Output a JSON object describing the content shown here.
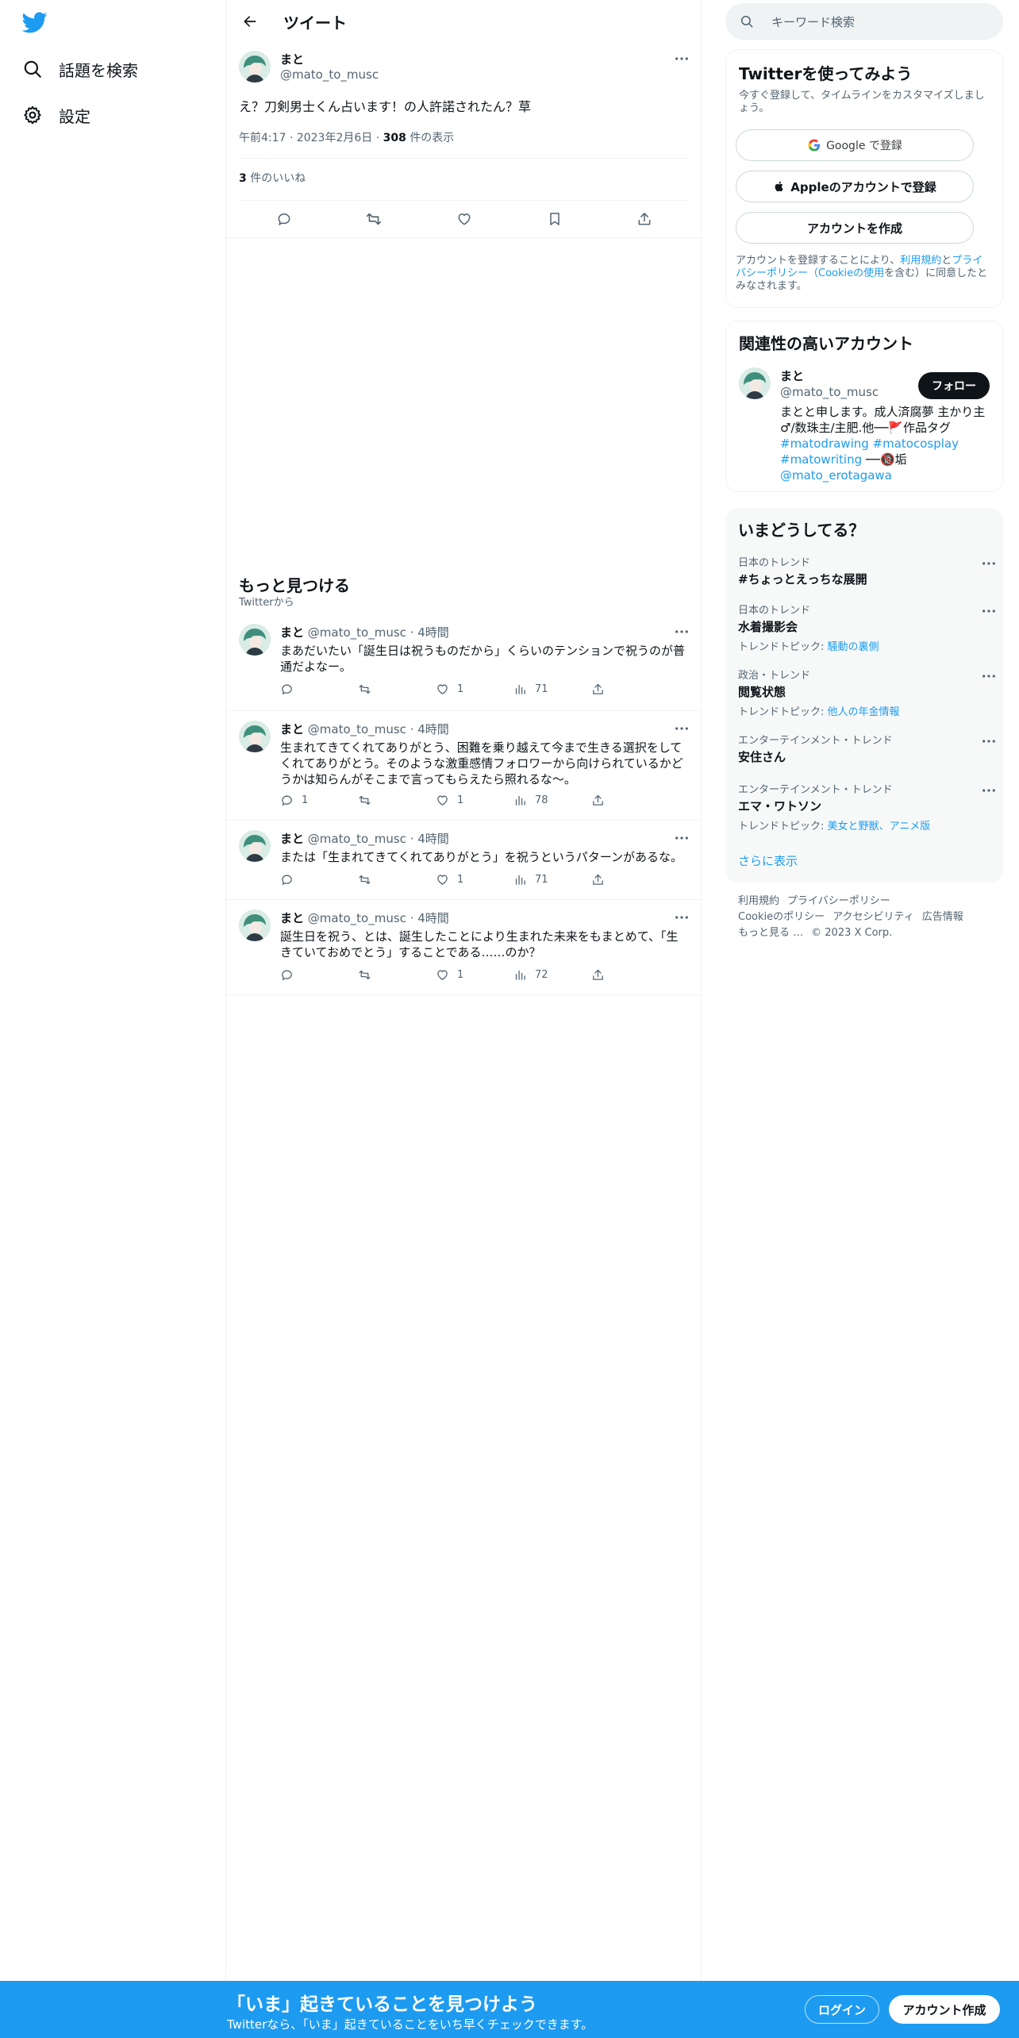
{
  "nav": {
    "items": [
      {
        "label": "話題を検索"
      },
      {
        "label": "設定"
      }
    ]
  },
  "header": {
    "title": "ツイート"
  },
  "tweet": {
    "name": "まと",
    "handle": "@mato_to_musc",
    "text": "え？刀剣男士くん占います！の人許諾されたん？草",
    "time": "午前4:17",
    "date": "2023年2月6日",
    "views_count": "308",
    "views_label": "件の表示",
    "likes_count": "3",
    "likes_label": "件のいいね"
  },
  "more": {
    "title": "もっと見つける",
    "subtitle": "Twitterから",
    "tweets": [
      {
        "name": "まと",
        "handle": "@mato_to_musc",
        "time": "4時間",
        "text": "まあだいたい「誕生日は祝うものだから」くらいのテンションで祝うのが普通だよなー。",
        "replies": "",
        "retweets": "",
        "likes": "1",
        "views": "71"
      },
      {
        "name": "まと",
        "handle": "@mato_to_musc",
        "time": "4時間",
        "text": "生まれてきてくれてありがとう、困難を乗り越えて今まで生きる選択をしてくれてありがとう。そのような激重感情フォロワーから向けられているかどうかは知らんがそこまで言ってもらえたら照れるな〜。",
        "replies": "1",
        "retweets": "",
        "likes": "1",
        "views": "78"
      },
      {
        "name": "まと",
        "handle": "@mato_to_musc",
        "time": "4時間",
        "text": "または「生まれてきてくれてありがとう」を祝うというパターンがあるな。",
        "replies": "",
        "retweets": "",
        "likes": "1",
        "views": "71"
      },
      {
        "name": "まと",
        "handle": "@mato_to_musc",
        "time": "4時間",
        "text": "誕生日を祝う、とは、誕生したことにより生まれた未来をもまとめて、「生きていておめでとう」することである……のか？",
        "replies": "",
        "retweets": "",
        "likes": "1",
        "views": "72"
      }
    ]
  },
  "sidebar": {
    "search_placeholder": "キーワード検索",
    "signup": {
      "title": "Twitterを使ってみよう",
      "subtitle": "今すぐ登録して、タイムラインをカスタマイズしましょう。",
      "google": "Google で登録",
      "apple": "Appleのアカウントで登録",
      "create": "アカウントを作成",
      "legal_prefix": "アカウントを登録することにより、",
      "legal_terms": "利用規約",
      "legal_and": "と",
      "legal_privacy": "プライバシーポリシー",
      "legal_open": "（",
      "legal_cookie": "Cookieの使用",
      "legal_suffix": "を含む）に同意したとみなされます。"
    },
    "related": {
      "title": "関連性の高いアカウント",
      "name": "まと",
      "handle": "@mato_to_musc",
      "follow": "フォロー",
      "bio_text": "まとと申します。成人済腐夢 主かり主♂/数珠主/主肥.他──🚩作品タグ",
      "bio_tags": "#matodrawing #matocosplay #matowriting",
      "bio_tail": " ──🔞垢",
      "bio_mention": "@mato_erotagawa"
    },
    "trends": {
      "title": "いまどうしてる？",
      "items": [
        {
          "context": "日本のトレンド",
          "title": "#ちょっとえっちな展開",
          "topic_label": "",
          "topic": ""
        },
        {
          "context": "日本のトレンド",
          "title": "水着撮影会",
          "topic_label": "トレンドトピック: ",
          "topic": "騒動の裏側"
        },
        {
          "context": "政治・トレンド",
          "title": "閲覧状態",
          "topic_label": "トレンドトピック: ",
          "topic": "他人の年金情報"
        },
        {
          "context": "エンターテインメント・トレンド",
          "title": "安住さん",
          "topic_label": "",
          "topic": ""
        },
        {
          "context": "エンターテインメント・トレンド",
          "title": "エマ・ワトソン",
          "topic_label": "トレンドトピック: ",
          "topic": "美女と野獣、アニメ版"
        }
      ],
      "show_more": "さらに表示"
    },
    "footer": {
      "links": [
        "利用規約",
        "プライバシーポリシー",
        "Cookieのポリシー",
        "アクセシビリティ",
        "広告情報",
        "もっと見る …"
      ],
      "copyright": "© 2023 X Corp."
    }
  },
  "bottom_bar": {
    "title": "「いま」起きていることを見つけよう",
    "subtitle": "Twitterなら、「いま」起きていることをいち早くチェックできます。",
    "login": "ログイン",
    "signup": "アカウント作成"
  },
  "colors": {
    "accent": "#1d9bf0",
    "text": "#0f1419",
    "muted": "#536471"
  }
}
